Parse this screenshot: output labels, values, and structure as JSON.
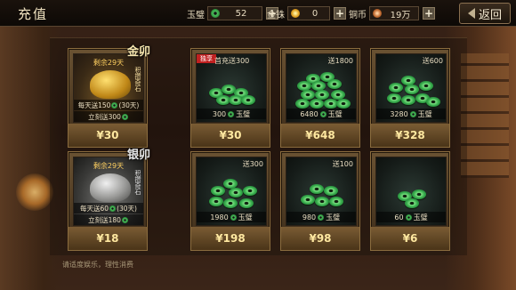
{
  "header": {
    "title": "充值",
    "back_label": "返回"
  },
  "currencies": [
    {
      "label": "玉璧",
      "value": "52",
      "icon": "jade-coin-icon"
    },
    {
      "label": "金铢",
      "value": "0",
      "icon": "gold-coin-icon"
    },
    {
      "label": "铜币",
      "value": "19万",
      "icon": "copper-coin-icon"
    }
  ],
  "monthly_cards": [
    {
      "days_left": "剩余29天",
      "stamp": "金卯",
      "vertical_text": "积攒奇石",
      "daily": "每天送150",
      "duration": "(30天)",
      "instant": "立刻送300",
      "price": "¥30"
    },
    {
      "days_left": "剩余29天",
      "stamp": "银卯",
      "vertical_text": "积攒奇石",
      "daily": "每天送60",
      "duration": "(30天)",
      "instant": "立刻送180",
      "price": "¥18"
    }
  ],
  "packs": [
    {
      "tag": "独享",
      "first_bonus": "首充送300",
      "bonus": "",
      "amount": "300",
      "unit": "玉璧",
      "price": "¥30"
    },
    {
      "tag": "",
      "first_bonus": "",
      "bonus": "送1800",
      "amount": "6480",
      "unit": "玉璧",
      "price": "¥648"
    },
    {
      "tag": "",
      "first_bonus": "",
      "bonus": "送600",
      "amount": "3280",
      "unit": "玉璧",
      "price": "¥328"
    },
    {
      "tag": "",
      "first_bonus": "",
      "bonus": "送300",
      "amount": "1980",
      "unit": "玉璧",
      "price": "¥198"
    },
    {
      "tag": "",
      "first_bonus": "",
      "bonus": "送100",
      "amount": "980",
      "unit": "玉璧",
      "price": "¥98"
    },
    {
      "tag": "",
      "first_bonus": "",
      "bonus": "",
      "amount": "60",
      "unit": "玉璧",
      "price": "¥6"
    }
  ],
  "footer": {
    "hint": "请适度娱乐，理性消费"
  }
}
